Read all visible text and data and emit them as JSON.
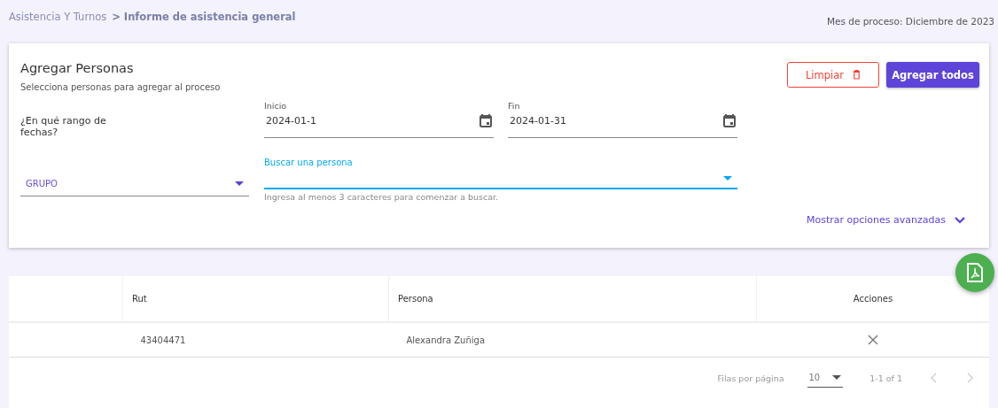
{
  "breadcrumb": {
    "parent": "Asistencia Y Turnos",
    "current": "> Informe de asistencia general"
  },
  "process_month": "Mes de proceso: Diciembre de 2023",
  "card": {
    "title": "Agregar Personas",
    "subtitle": "Selecciona personas para agregar al proceso",
    "buttons": [
      {
        "label": "Limpiar",
        "kind": "outline"
      },
      {
        "label": "Agregar todos",
        "kind": "primary"
      }
    ],
    "range_question": "¿En qué rango de fechas?",
    "start": {
      "label": "Inicio",
      "value": "2024-01-1"
    },
    "end": {
      "label": "Fin",
      "value": "2024-01-31"
    },
    "group": {
      "placeholder": "GRUPO"
    },
    "search": {
      "label": "Buscar una persona",
      "hint": "Ingresa al menos 3 caracteres para comenzar a buscar.",
      "focused": true
    },
    "advanced": "Mostrar opciones avanzadas"
  },
  "table": {
    "columns": [
      "",
      "Rut",
      "Persona",
      "Acciones"
    ],
    "rows": [
      {
        "rut": "43404471",
        "persona": "Alexandra Zuñiga"
      }
    ]
  },
  "pagination": {
    "label": "Filas por página",
    "rows_per_page": "10",
    "range": "1-1 of 1",
    "prev_disabled": true,
    "next_disabled": true
  }
}
